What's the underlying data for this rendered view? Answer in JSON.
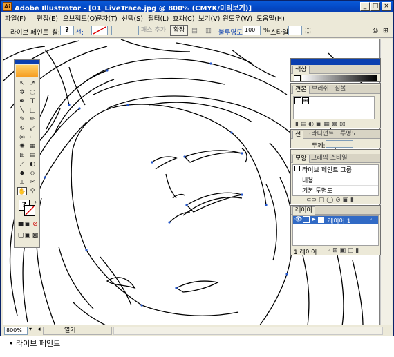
{
  "window": {
    "title": "Adobe Illustrator - [01_LiveTrace.jpg @ 800% (CMYK/미리보기)]",
    "app_icon": "Ai",
    "min": "_",
    "max": "□",
    "close": "×"
  },
  "menu": [
    "파일(F)",
    "편집(E)",
    "오브젝트(O)",
    "문자(T)",
    "선택(S)",
    "필터(L)",
    "효과(C)",
    "보기(V)",
    "윈도우(W)",
    "도움말(H)"
  ],
  "control": {
    "object_type": "라이브 페인트",
    "fill_label": "칠:",
    "fill_value": "?",
    "stroke_label": "선:",
    "path_button": "패스 추가",
    "expand_button": "확장",
    "opacity_label": "불투명도:",
    "opacity_value": "100",
    "opacity_unit": "%",
    "style_label": "스타일:"
  },
  "panels": {
    "color": {
      "tab": "색상"
    },
    "swatches": {
      "tabs": [
        "견본",
        "브러쉬",
        "심볼"
      ]
    },
    "stroke": {
      "tabs": [
        "선",
        "그라디언트",
        "투명도"
      ],
      "weight_label": "두께:"
    },
    "appearance": {
      "tabs": [
        "모양",
        "그래픽 스타일"
      ],
      "title": "라이브 페인트 그룹",
      "rows": [
        "내용",
        "기본 투명도"
      ]
    },
    "layers": {
      "tab": "레이어",
      "layer_name": "레이어 1",
      "count": "1 레이어"
    }
  },
  "status": {
    "zoom": "800%",
    "info": "열기"
  },
  "caption": "라이브 페인트",
  "colors": {
    "title_blue": "#0348c4",
    "panel_bg": "#ece9d8",
    "selection": "#316ac5",
    "toolbox_accent": "#f59a1d"
  }
}
